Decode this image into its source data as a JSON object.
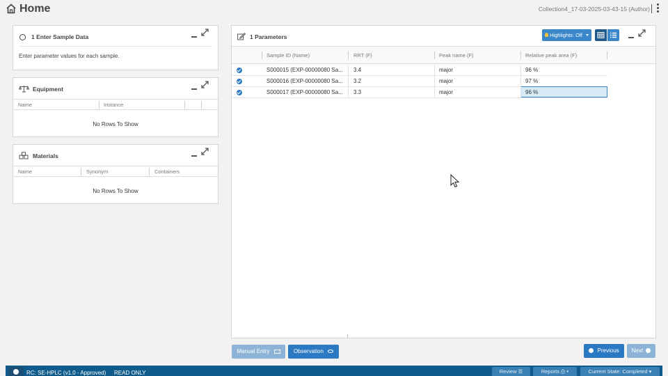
{
  "header": {
    "title": "Home",
    "collection": "Collection4_17-03-2025-03-43-15 (Author)"
  },
  "left": {
    "step": {
      "title": "1 Enter Sample Data",
      "description": "Enter parameter values for each sample."
    },
    "equipment": {
      "title": "Equipment",
      "columns": [
        "Name",
        "Instance"
      ],
      "empty": "No Rows To Show"
    },
    "materials": {
      "title": "Materials",
      "columns": [
        "Name",
        "Synonym",
        "Containers"
      ],
      "empty": "No Rows To Show"
    }
  },
  "params": {
    "title": "1 Parameters",
    "highlights": "Highlights: Off",
    "columns": [
      "Sample ID (Name)",
      "RRT (F)",
      "Peak name (F)",
      "Relative peak area (F)"
    ],
    "rows": [
      {
        "sample": "S000015 (EXP-00000080 Sa...",
        "rrt": "3.4",
        "peak": "major",
        "area": "96 %"
      },
      {
        "sample": "S000016 (EXP-00000080 Sa...",
        "rrt": "3.2",
        "peak": "major",
        "area": "97 %"
      },
      {
        "sample": "S000017 (EXP-00000080 Sa...",
        "rrt": "3.3",
        "peak": "major",
        "area": "96 %"
      }
    ]
  },
  "actions": {
    "manual_entry": "Manual Entry",
    "observation": "Observation",
    "previous": "Previous",
    "next": "Next"
  },
  "footer": {
    "status": "RC: SE-HPLC (v1.0 - Approved)",
    "mode": "READ ONLY",
    "review": "Review",
    "reports": "Reports",
    "state": "Current State: Completed"
  },
  "colors": {
    "primary": "#2b79c2",
    "footer": "#0f5c8c",
    "selected_cell": "#d6eaf8"
  }
}
